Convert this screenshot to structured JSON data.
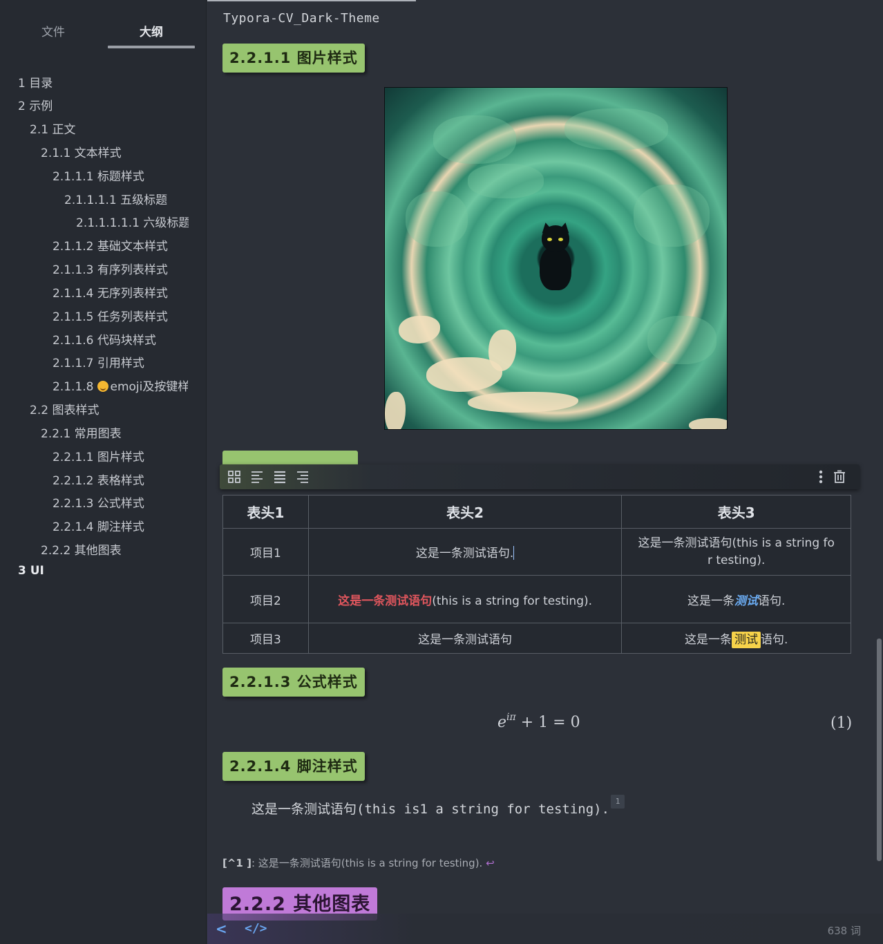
{
  "sidebar": {
    "tabs": {
      "files": "文件",
      "outline": "大纲"
    },
    "outline": [
      {
        "label": "1 目录",
        "level": 0,
        "bold": false
      },
      {
        "label": "2 示例",
        "level": 0,
        "bold": false
      },
      {
        "label": "2.1 正文",
        "level": 1,
        "bold": false
      },
      {
        "label": "2.1.1 文本样式",
        "level": 2,
        "bold": false
      },
      {
        "label": "2.1.1.1 标题样式",
        "level": 3,
        "bold": false
      },
      {
        "label": "2.1.1.1.1 五级标题",
        "level": 4,
        "bold": false
      },
      {
        "label": "2.1.1.1.1.1 六级标题",
        "level": 5,
        "bold": false
      },
      {
        "label": "2.1.1.2 基础文本样式",
        "level": 3,
        "bold": false
      },
      {
        "label": "2.1.1.3 有序列表样式",
        "level": 3,
        "bold": false
      },
      {
        "label": "2.1.1.4 无序列表样式",
        "level": 3,
        "bold": false
      },
      {
        "label": "2.1.1.5 任务列表样式",
        "level": 3,
        "bold": false
      },
      {
        "label": "2.1.1.6 代码块样式",
        "level": 3,
        "bold": false
      },
      {
        "label": "2.1.1.7 引用样式",
        "level": 3,
        "bold": false
      },
      {
        "label": "2.1.1.8",
        "suffix": "emoji及按键样式",
        "emoji": "smiling-face",
        "level": 3,
        "bold": false
      },
      {
        "label": "2.2 图表样式",
        "level": 1,
        "bold": false
      },
      {
        "label": "2.2.1 常用图表",
        "level": 2,
        "bold": false
      },
      {
        "label": "2.2.1.1 图片样式",
        "level": 3,
        "bold": false
      },
      {
        "label": "2.2.1.2 表格样式",
        "level": 3,
        "bold": false
      },
      {
        "label": "2.2.1.3 公式样式",
        "level": 3,
        "bold": false
      },
      {
        "label": "2.2.1.4 脚注样式",
        "level": 3,
        "bold": false
      },
      {
        "label": "2.2.2 其他图表",
        "level": 2,
        "bold": false
      },
      {
        "label": "3 UI",
        "level": 0,
        "bold": true
      }
    ]
  },
  "document": {
    "tab_title": "Typora-CV_Dark-Theme",
    "headings": {
      "image": "2.2.1.1 图片样式",
      "table": "2.2.1.2 表格样式",
      "formula": "2.2.1.3 公式样式",
      "footnote": "2.2.1.4 脚注样式",
      "other": "2.2.2 其他图表"
    },
    "table": {
      "headers": [
        "表头1",
        "表头2",
        "表头3"
      ],
      "rows": {
        "r1": {
          "c1": "项目1",
          "c2": "这是一条测试语句.",
          "c3": "这是一条测试语句(this is a string for testing)."
        },
        "r2": {
          "c1": "项目2",
          "c2_red": "这是一条测试语句",
          "c2_rest": "(this is a string for testing).",
          "c3_pre": "这是一条",
          "c3_blue": "测试",
          "c3_post": "语句."
        },
        "r3": {
          "c1": "项目3",
          "c2": "这是一条测试语句",
          "c3_pre": "这是一条",
          "c3_hl": "测试",
          "c3_post": "语句."
        }
      }
    },
    "formula": {
      "base": "e",
      "exponent": "iπ",
      "rest": "+ 1 = 0",
      "number": "(1)"
    },
    "footnote_text": "这是一条测试语句(this is1 a string for testing).",
    "footnote_marker": "1",
    "footnote_def": {
      "ref": "[^1 ]",
      "sep": ": ",
      "text": "这是一条测试语句(this is a string for testing).",
      "back": "↩"
    }
  },
  "table_toolbar": {
    "icons": [
      "grid-icon",
      "align-left-icon",
      "align-center-icon",
      "align-right-icon",
      "more-vertical-icon",
      "trash-icon"
    ]
  },
  "status_bar": {
    "word_count": "638 词",
    "back_glyph": "<",
    "code_glyph": "</>"
  },
  "colors": {
    "h4_bg": "#97c46f",
    "h3_bg": "#c07ad8",
    "accent_blue": "#6aa6f0",
    "red_text": "#e0565d",
    "highlight": "#f6d24a"
  }
}
